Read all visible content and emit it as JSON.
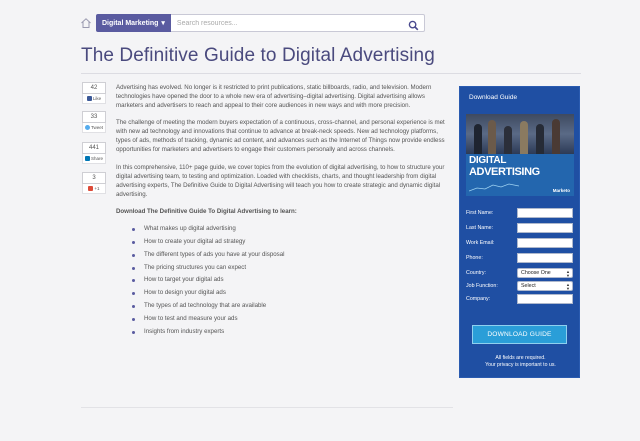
{
  "header": {
    "category_label": "Digital Marketing",
    "search_placeholder": "Search resources..."
  },
  "title": "The Definitive Guide to Digital Advertising",
  "share": {
    "facebook": {
      "count": "42",
      "label": "Like"
    },
    "twitter": {
      "count": "33",
      "label": "Tweet"
    },
    "linkedin": {
      "count": "441",
      "label": "Share"
    },
    "googleplus": {
      "count": "3",
      "label": "+1"
    }
  },
  "content": {
    "paragraphs": [
      "Advertising has evolved. No longer is it restricted to print publications, static billboards, radio, and television. Modern technologies have opened the door to a whole new era of advertising–digital advertising. Digital advertising allows marketers and advertisers to reach and appeal to their core audiences in new ways and with more precision.",
      "The challenge of meeting the modern buyers expectation of a continuous, cross-channel, and personal experience is met with new ad technology and innovations that continue to advance at break-neck speeds. New ad technology platforms, types of ads, methods of tracking, dynamic ad content, and advances such as the Internet of Things now provide endless opportunities for marketers and advertisers to engage their customers personally and across channels.",
      "In this comprehensive, 110+ page guide, we cover topics from the evolution of digital advertising, to how to structure your digital advertising team, to testing and optimization. Loaded with checklists, charts, and thought leadership from digital advertising experts, The Definitive Guide to Digital Advertising will teach you how to create strategic and dynamic digital advertising."
    ],
    "lead": "Download The Definitive Guide To Digital Advertising to learn:",
    "bullets": [
      "What makes up digital advertising",
      "How to create your digital ad strategy",
      "The different types of ads you have at your disposal",
      "The pricing structures you can expect",
      "How to target your digital ads",
      "How to design your digital ads",
      "The types of ad technology that are available",
      "How to test and measure your ads",
      "Insights from industry experts"
    ]
  },
  "form": {
    "title": "Download Guide",
    "cover": {
      "line1": "DIGITAL",
      "line2": "ADVERTISING",
      "brand": "Marketo"
    },
    "fields": {
      "first_name": "First Name:",
      "last_name": "Last Name:",
      "work_email": "Work Email:",
      "phone": "Phone:",
      "country": "Country:",
      "job_function": "Job Function:",
      "company": "Company:"
    },
    "country_value": "Choose One",
    "job_function_value": "Select",
    "button": "DOWNLOAD GUIDE",
    "note_line1": "All fields are required.",
    "note_line2": "Your privacy is important to us."
  },
  "colors": {
    "accent": "#5a5ba0",
    "panel": "#1f4fa3",
    "button": "#2a9ed8",
    "title": "#4a4a7e"
  }
}
